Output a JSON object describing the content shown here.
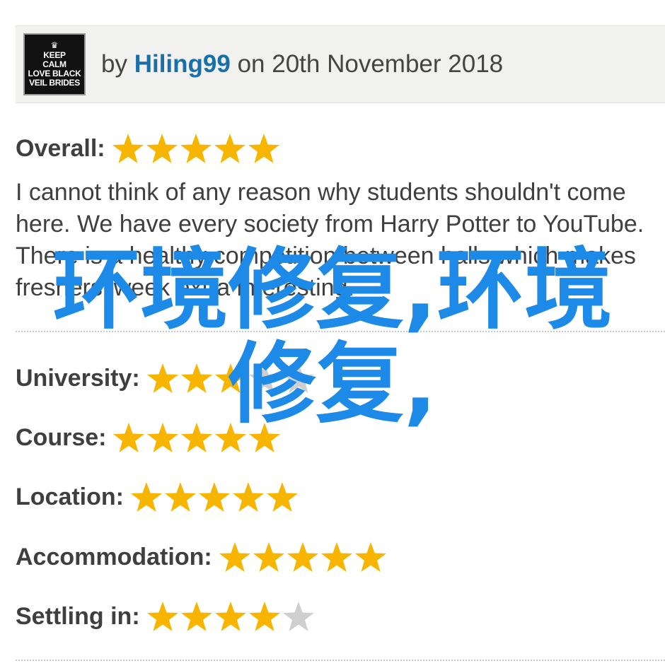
{
  "header": {
    "avatar_lines": [
      "KEEP",
      "CALM",
      "LOVE BLACK",
      "VEIL BRIDES"
    ],
    "by": "by",
    "username": "Hiling99",
    "on": "on",
    "date": "20th November 2018"
  },
  "overall": {
    "label": "Overall:",
    "rating": 5,
    "max": 5
  },
  "review": {
    "text": "I cannot think of any reason why students shouldn't come here. We have every society from Harry Potter to YouTube. There is a healthy competition between halls which makes freshers' week extra interesting."
  },
  "ratings": [
    {
      "label": "University:",
      "rating": 3,
      "max": 5
    },
    {
      "label": "Course:",
      "rating": 5,
      "max": 5
    },
    {
      "label": "Location:",
      "rating": 5,
      "max": 5
    },
    {
      "label": "Accommodation:",
      "rating": 5,
      "max": 5
    },
    {
      "label": "Settling in:",
      "rating": 4,
      "max": 5
    }
  ],
  "watermark": {
    "line1": "环境修复,环境",
    "line2": "修复,"
  },
  "colors": {
    "star_filled": "#f7b500",
    "star_empty": "#cfcfcf",
    "username": "#1b6fa8",
    "watermark": "#1d8ae8"
  }
}
